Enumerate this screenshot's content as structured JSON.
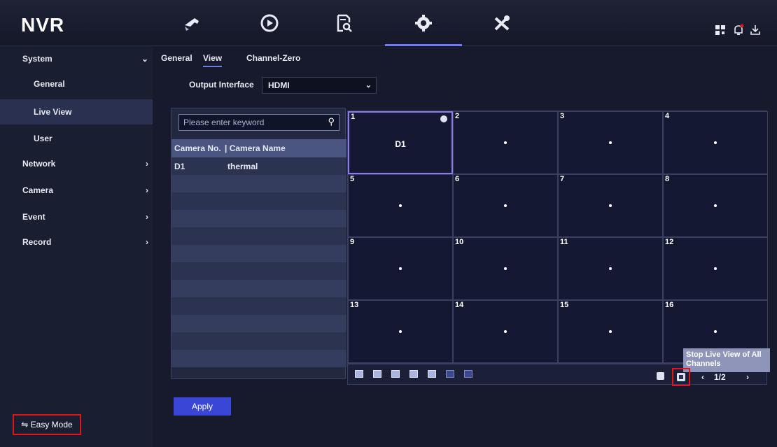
{
  "header": {
    "logo": "NVR",
    "nav": [
      {
        "name": "live-view-nav",
        "icon": "camera-icon"
      },
      {
        "name": "playback-nav",
        "icon": "playback-icon"
      },
      {
        "name": "search-nav",
        "icon": "file-search-icon"
      },
      {
        "name": "settings-nav",
        "icon": "gear-icon",
        "active": true
      },
      {
        "name": "maintenance-nav",
        "icon": "wrench-screwdriver-icon"
      }
    ],
    "right_icons": [
      "qr-code-icon",
      "bell-icon",
      "download-icon"
    ]
  },
  "sidebar": {
    "items": [
      {
        "label": "System",
        "expanded": true
      },
      {
        "label": "General"
      },
      {
        "label": "Live View",
        "active": true
      },
      {
        "label": "User"
      },
      {
        "label": "Network",
        "arrow": "›"
      },
      {
        "label": "Camera",
        "arrow": "›"
      },
      {
        "label": "Event",
        "arrow": "›"
      },
      {
        "label": "Record",
        "arrow": "›"
      }
    ],
    "system_arrow": "⌄",
    "easy_mode": "⇋ Easy Mode"
  },
  "tabs": [
    {
      "label": "General"
    },
    {
      "label": "View",
      "active": true
    },
    {
      "label": "Channel-Zero"
    }
  ],
  "output": {
    "label": "Output Interface",
    "value": "HDMI"
  },
  "camera_list": {
    "search_placeholder": "Please enter keyword",
    "headers": [
      "Camera No.",
      "| Camera Name"
    ],
    "rows": [
      {
        "no": "D1",
        "name": "thermal"
      }
    ]
  },
  "grid": {
    "cells": [
      {
        "num": "1",
        "camera": "D1"
      },
      {
        "num": "2"
      },
      {
        "num": "3"
      },
      {
        "num": "4"
      },
      {
        "num": "5"
      },
      {
        "num": "6"
      },
      {
        "num": "7"
      },
      {
        "num": "8"
      },
      {
        "num": "9"
      },
      {
        "num": "10"
      },
      {
        "num": "11"
      },
      {
        "num": "12"
      },
      {
        "num": "13"
      },
      {
        "num": "14"
      },
      {
        "num": "15"
      },
      {
        "num": "16"
      }
    ]
  },
  "pager": {
    "prev": "‹",
    "current": "1/2",
    "next": "›"
  },
  "tooltip": "Stop Live View of All Channels",
  "apply_label": "Apply",
  "colors": {
    "accent": "#3a46d6",
    "highlight": "#e0161c",
    "tab_underline": "#6e7cf0"
  }
}
